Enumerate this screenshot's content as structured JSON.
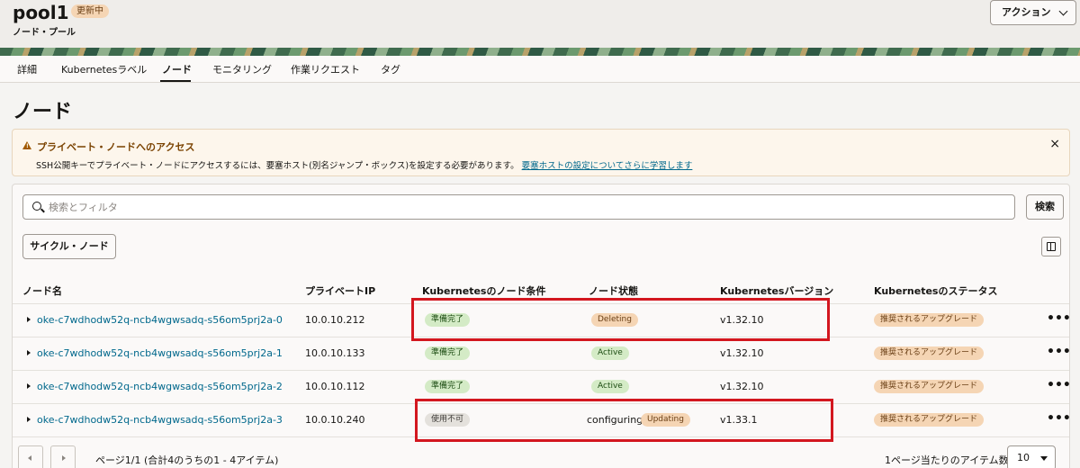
{
  "header": {
    "title": "pool1",
    "badge": "更新中",
    "subtitle": "ノード・プール",
    "action_button": "アクション"
  },
  "tabs": [
    {
      "label": "詳細",
      "active": false
    },
    {
      "label": "Kubernetesラベル",
      "active": false
    },
    {
      "label": "ノード",
      "active": true
    },
    {
      "label": "モニタリング",
      "active": false
    },
    {
      "label": "作業リクエスト",
      "active": false
    },
    {
      "label": "タグ",
      "active": false
    }
  ],
  "page_heading": "ノード",
  "alert": {
    "title": "プライベート・ノードへのアクセス",
    "text": "SSH公開キーでプライベート・ノードにアクセスするには、要塞ホスト(別名ジャンプ・ボックス)を設定する必要があります。",
    "link": "要塞ホストの設定についてさらに学習します",
    "close": "×"
  },
  "search": {
    "placeholder": "検索とフィルタ",
    "button": "検索"
  },
  "cycle_button": "サイクル・ノード",
  "table": {
    "headers": [
      "ノード名",
      "プライベートIP",
      "Kubernetesのノード条件",
      "ノード状態",
      "Kubernetesバージョン",
      "Kubernetesのステータス"
    ],
    "rows": [
      {
        "name": "oke-c7wdhodw52q-ncb4wgwsadq-s56om5prj2a-0",
        "ip": "10.0.10.212",
        "condition": "準備完了",
        "state_text": "",
        "state_badge": "Deleting",
        "version": "v1.32.10",
        "status": "推奨されるアップグレード"
      },
      {
        "name": "oke-c7wdhodw52q-ncb4wgwsadq-s56om5prj2a-1",
        "ip": "10.0.10.133",
        "condition": "準備完了",
        "state_text": "",
        "state_badge": "Active",
        "version": "v1.32.10",
        "status": "推奨されるアップグレード"
      },
      {
        "name": "oke-c7wdhodw52q-ncb4wgwsadq-s56om5prj2a-2",
        "ip": "10.0.10.112",
        "condition": "準備完了",
        "state_text": "",
        "state_badge": "Active",
        "version": "v1.32.10",
        "status": "推奨されるアップグレード"
      },
      {
        "name": "oke-c7wdhodw52q-ncb4wgwsadq-s56om5prj2a-3",
        "ip": "10.0.10.240",
        "condition": "使用不可",
        "state_text": "configuring",
        "state_badge": "Updating",
        "version": "v1.33.1",
        "status": "推奨されるアップグレード"
      }
    ],
    "row_menu": "•••"
  },
  "pagination": {
    "summary": "ページ1/1 (合計4のうちの1 - 4アイテム)",
    "per_page_label": "1ページ当たりのアイテム数",
    "per_page_value": "10"
  },
  "colors": {
    "link": "#00688c",
    "highlight": "#d3171f",
    "green_badge": "#d4ebc6",
    "orange_badge": "#f5d5b4"
  }
}
